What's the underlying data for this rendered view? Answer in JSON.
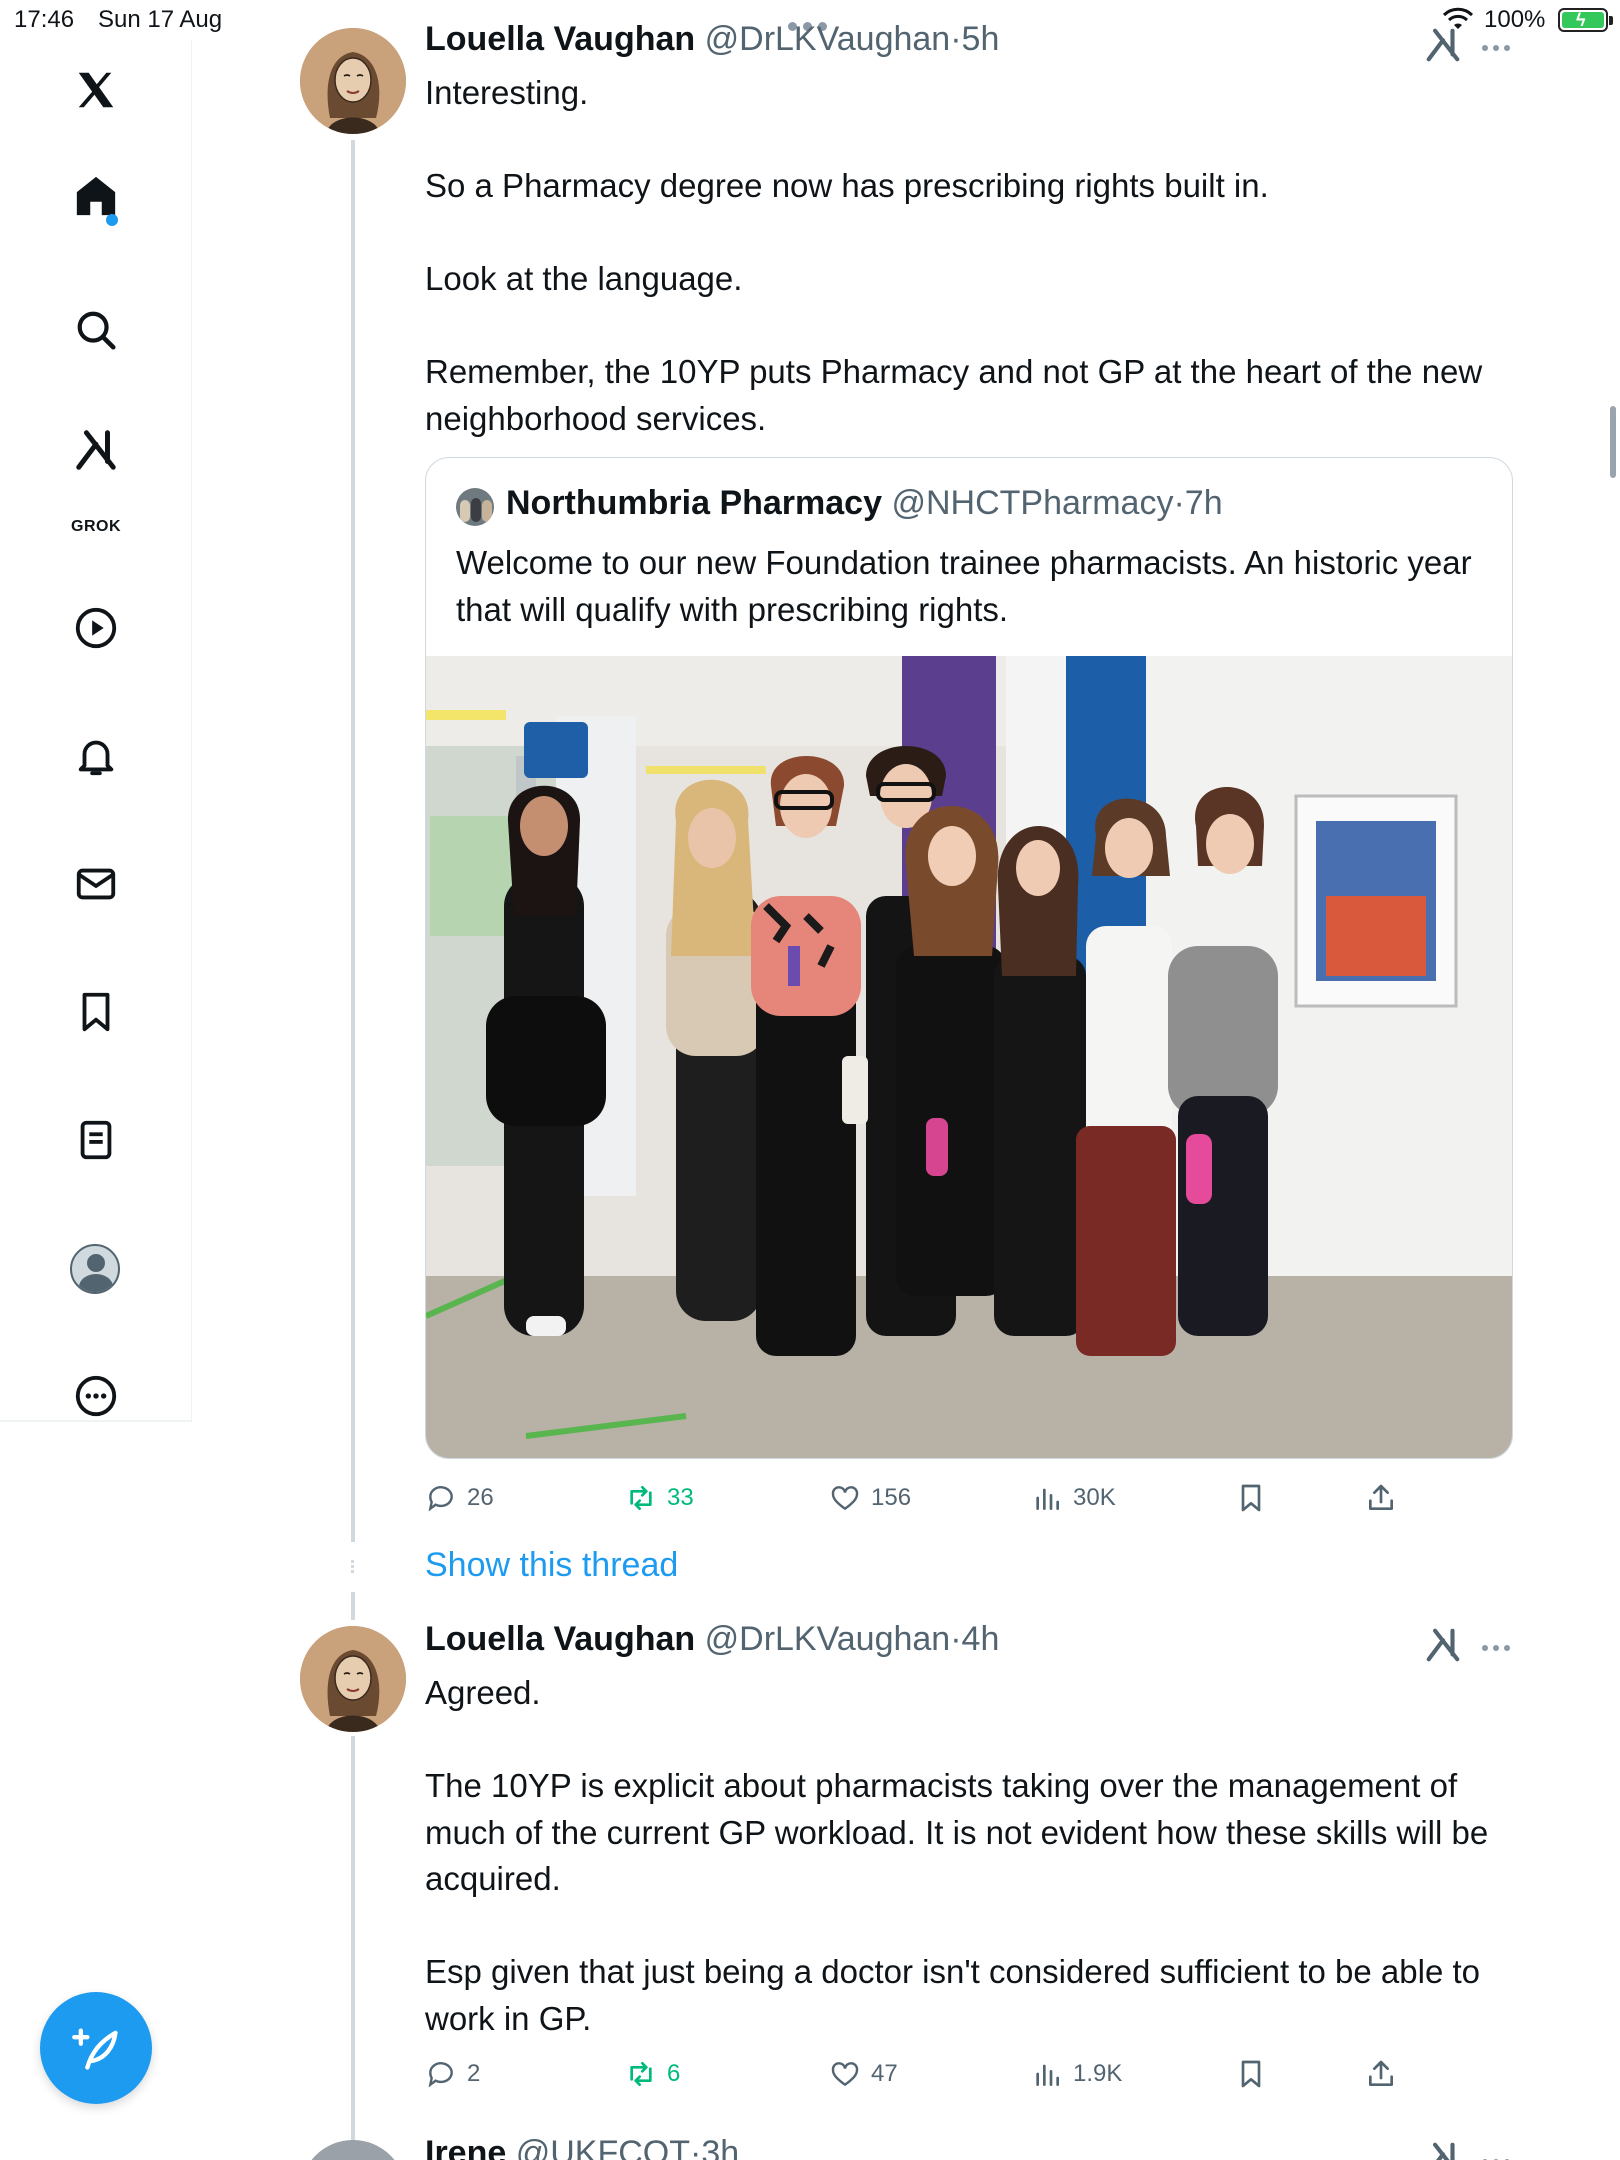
{
  "status_bar": {
    "time": "17:46",
    "date": "Sun 17 Aug",
    "battery": "100%"
  },
  "sidebar": {
    "grok_label": "GROK"
  },
  "tweets": [
    {
      "name": "Louella Vaughan",
      "handle": "@DrLKVaughan",
      "separator": "·",
      "time": "5h",
      "paragraphs": [
        "Interesting.",
        "",
        "So a Pharmacy degree now has prescribing rights built in.",
        "",
        "Look at the language.",
        "",
        "Remember, the 10YP puts Pharmacy and not GP at the heart of the new neighborhood services."
      ],
      "quote": {
        "name": "Northumbria Pharmacy",
        "handle": "@NHCTPharmacy",
        "separator": "·",
        "time": "7h",
        "text": "Welcome to our new Foundation trainee pharmacists. An historic year that will qualify with prescribing rights."
      },
      "actions": {
        "replies": "26",
        "reposts": "33",
        "likes": "156",
        "views": "30K"
      }
    },
    {
      "name": "Louella Vaughan",
      "handle": "@DrLKVaughan",
      "separator": "·",
      "time": "4h",
      "paragraphs": [
        "Agreed.",
        "",
        "The 10YP is explicit about pharmacists taking over the management of much of the current GP workload. It is not evident how these skills will be acquired.",
        "",
        "Esp given that just being a doctor isn't considered sufficient to be able to work in GP."
      ],
      "actions": {
        "replies": "2",
        "reposts": "6",
        "likes": "47",
        "views": "1.9K"
      }
    }
  ],
  "show_thread_label": "Show this thread",
  "next_tweet_peek": {
    "name": "Irene",
    "handle": "@UKFCOT",
    "separator": "·",
    "time": "3h"
  },
  "colors": {
    "accent": "#1d9bf0",
    "repost": "#00ba7c",
    "text": "#0f1419",
    "muted": "#536471"
  }
}
